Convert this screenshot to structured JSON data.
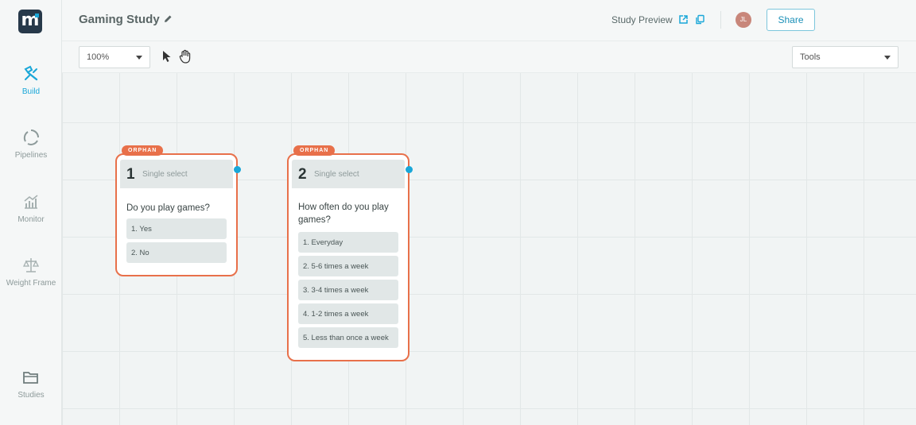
{
  "app": {
    "logo_letter": "m"
  },
  "sidebar": {
    "items": [
      {
        "label": "Build",
        "icon": "build-icon"
      },
      {
        "label": "Pipelines",
        "icon": "pipelines-icon"
      },
      {
        "label": "Monitor",
        "icon": "monitor-icon"
      },
      {
        "label": "Weight Frame",
        "icon": "scale-icon"
      },
      {
        "label": "Studies",
        "icon": "folder-icon"
      }
    ]
  },
  "header": {
    "title": "Gaming Study",
    "preview_label": "Study Preview",
    "avatar_initials": "JL",
    "share_label": "Share"
  },
  "toolbar": {
    "zoom_value": "100%",
    "tools_value": "Tools"
  },
  "nodes": [
    {
      "badge": "ORPHAN",
      "number": "1",
      "type": "Single select",
      "question": "Do you play games?",
      "options": [
        "1. Yes",
        "2. No"
      ]
    },
    {
      "badge": "ORPHAN",
      "number": "2",
      "type": "Single select",
      "question": "How often do you play games?",
      "options": [
        "1. Everyday",
        "2. 5-6 times a week",
        "3. 3-4 times a week",
        "4. 1-2 times a week",
        "5. Less than once a week"
      ]
    }
  ],
  "colors": {
    "accent": "#1aa7d8",
    "orphan": "#e8704a",
    "logo_bg": "#27394a"
  }
}
